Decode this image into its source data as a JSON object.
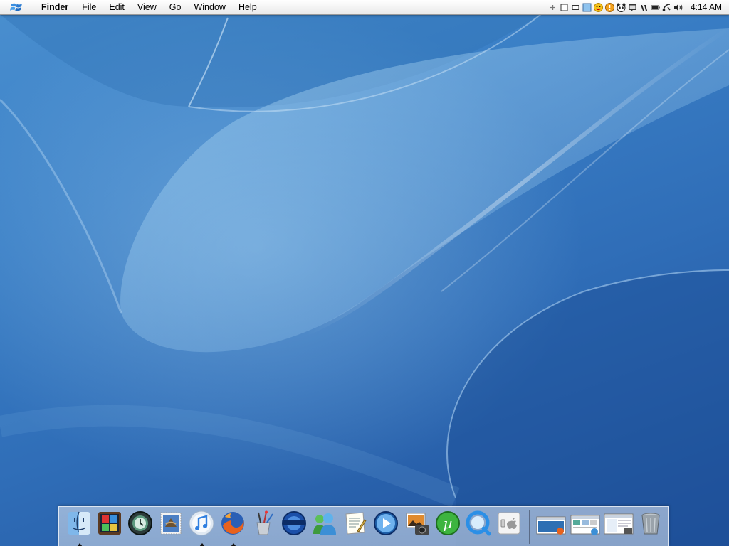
{
  "menubar": {
    "logo_icon": "windows-flag-icon",
    "app_name": "Finder",
    "menus": [
      "File",
      "Edit",
      "View",
      "Go",
      "Window",
      "Help"
    ],
    "tray_icons": [
      "add-icon",
      "window-icon",
      "display-icon",
      "finder-tray-icon",
      "smiley-icon",
      "emoticon-icon",
      "panda-icon",
      "messenger-icon",
      "vmware-icon",
      "battery-icon",
      "network-icon",
      "volume-icon"
    ],
    "clock": "4:14 AM"
  },
  "dock": {
    "apps": [
      {
        "name": "Finder",
        "icon": "finder-icon",
        "running": true
      },
      {
        "name": "Photo Booth",
        "icon": "photo-booth-icon",
        "running": false
      },
      {
        "name": "Time Machine",
        "icon": "time-machine-icon",
        "running": false
      },
      {
        "name": "Mail",
        "icon": "mail-stamp-icon",
        "running": false
      },
      {
        "name": "iTunes",
        "icon": "itunes-icon",
        "running": true
      },
      {
        "name": "Firefox",
        "icon": "firefox-icon",
        "running": true
      },
      {
        "name": "Paint",
        "icon": "paint-brushes-icon",
        "running": false
      },
      {
        "name": "DVD Player",
        "icon": "dvd-player-icon",
        "running": false
      },
      {
        "name": "Messenger",
        "icon": "messenger-buddies-icon",
        "running": false
      },
      {
        "name": "TextEdit",
        "icon": "textedit-icon",
        "running": false
      },
      {
        "name": "Media Player",
        "icon": "media-player-icon",
        "running": false
      },
      {
        "name": "iPhoto",
        "icon": "iphoto-icon",
        "running": false
      },
      {
        "name": "uTorrent",
        "icon": "utorrent-icon",
        "running": false
      },
      {
        "name": "QuickTime",
        "icon": "quicktime-icon",
        "running": false
      },
      {
        "name": "System Preferences",
        "icon": "apple-switch-icon",
        "running": false
      }
    ],
    "minimized": [
      {
        "name": "Firefox window",
        "icon": "minimized-window-icon"
      },
      {
        "name": "Explorer window",
        "icon": "minimized-window-icon"
      },
      {
        "name": "Finder window",
        "icon": "minimized-window-icon"
      }
    ],
    "trash": {
      "name": "Trash",
      "icon": "trash-icon"
    }
  },
  "colors": {
    "wallpaper_top": "#4a8fcf",
    "wallpaper_bottom": "#1f4f9a",
    "menubar_bg": "#f2f2f2"
  }
}
